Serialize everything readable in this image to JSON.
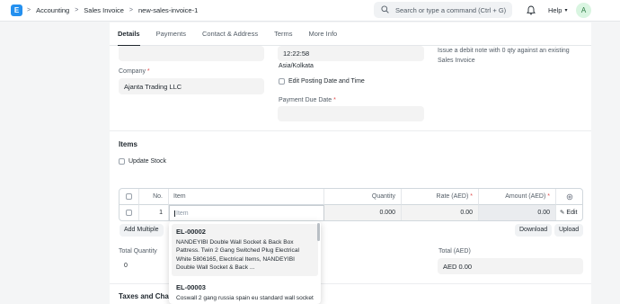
{
  "navbar": {
    "logo_letter": "E",
    "breadcrumbs": [
      "Accounting",
      "Sales Invoice",
      "new-sales-invoice-1"
    ],
    "search_placeholder": "Search or type a command (Ctrl + G)",
    "help_label": "Help",
    "avatar_initial": "A"
  },
  "tabs": [
    {
      "label": "Details",
      "active": true
    },
    {
      "label": "Payments",
      "active": false
    },
    {
      "label": "Contact & Address",
      "active": false
    },
    {
      "label": "Terms",
      "active": false
    },
    {
      "label": "More Info",
      "active": false
    }
  ],
  "form": {
    "posting_time": "12:22:58",
    "timezone": "Asia/Kolkata",
    "edit_posting_label": "Edit Posting Date and Time",
    "payment_due_label": "Payment Due Date",
    "company_label": "Company",
    "company_value": "Ajanta Trading LLC",
    "required_mark": "*",
    "is_return_desc": "Issue a debit note with 0 qty against an existing Sales Invoice"
  },
  "items_section": {
    "heading": "Items",
    "update_stock_label": "Update Stock",
    "columns": {
      "no": "No.",
      "item": "Item",
      "quantity": "Quantity",
      "rate": "Rate (AED)",
      "amount": "Amount (AED)"
    },
    "row": {
      "no": "1",
      "item_placeholder": "Item",
      "quantity": "0.000",
      "rate": "0.00",
      "amount": "0.00",
      "edit_label": "Edit"
    },
    "add_multiple_label": "Add Multiple",
    "download_label": "Download",
    "upload_label": "Upload"
  },
  "totals": {
    "total_quantity_label": "Total Quantity",
    "total_quantity_value": "0",
    "total_label": "Total (AED)",
    "total_value": "AED 0.00"
  },
  "taxes_heading": "Taxes and Charges",
  "dropdown": {
    "items": [
      {
        "code": "EL-00002",
        "desc": "NANDEYIBI Double Wall Socket & Back Box Pattress. Twin 2 Gang Switched Plug Electrical White 5806165, Electrical Items, NANDEYIBI Double Wall Socket & Back ..."
      },
      {
        "code": "EL-00003",
        "desc": "Coswall 2 gang russia spain eu standard wall socket"
      }
    ]
  },
  "colors": {
    "brand": "#2490ef",
    "required": "#e24c4c",
    "input_bg": "#f3f3f3"
  }
}
